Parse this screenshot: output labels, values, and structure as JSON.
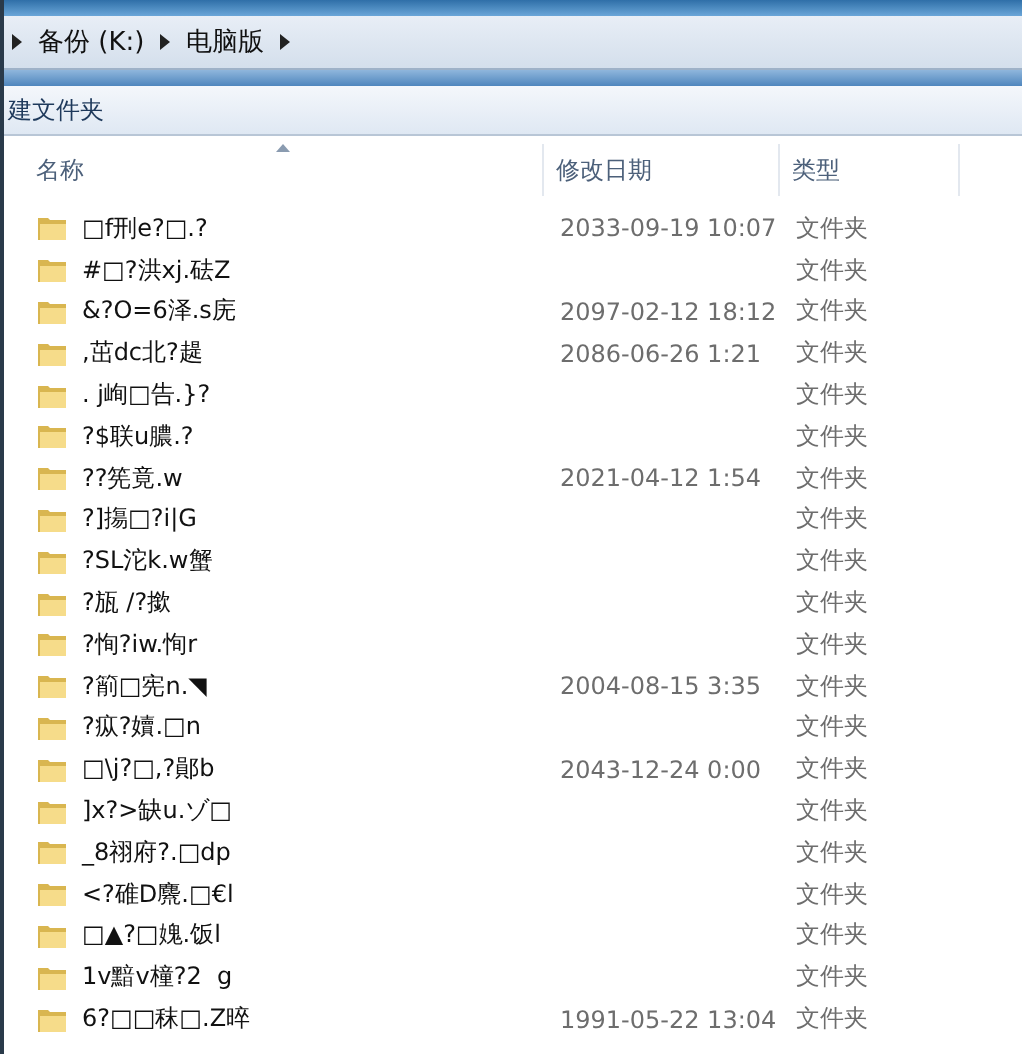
{
  "breadcrumb": [
    {
      "label": "备份 (K:)"
    },
    {
      "label": "电脑版"
    }
  ],
  "toolbar": {
    "new_folder": "建文件夹"
  },
  "table": {
    "columns": [
      "名称",
      "修改日期",
      "类型"
    ],
    "rows": [
      {
        "name": "□f刑e?□.?",
        "date": "2033-09-19 10:07",
        "type": "文件夹"
      },
      {
        "name": "#□?洪xj.砝Z",
        "type": "文件夹"
      },
      {
        "name": "&?O=6泽.s庑",
        "date": "2097-02-12 18:12",
        "type": "文件夹"
      },
      {
        "name": ",茁dc北?趧",
        "date": "2086-06-26 1:21",
        "type": "文件夹"
      },
      {
        "name": ". j峋□告.}?",
        "type": "文件夹"
      },
      {
        "name": "?$联u膿.?",
        "type": "文件夹"
      },
      {
        "name": "??筅竟.w",
        "date": "2021-04-12 1:54",
        "type": "文件夹"
      },
      {
        "name": "?]摥□?i|G",
        "type": "文件夹"
      },
      {
        "name": "?SL沱k.w蟹",
        "type": "文件夹"
      },
      {
        "name": "?瓬 /?撳",
        "type": "文件夹"
      },
      {
        "name": "?恂?iw.恂r",
        "type": "文件夹"
      },
      {
        "name": "?箾□宪n.◥",
        "date": "2004-08-15 3:35",
        "type": "文件夹"
      },
      {
        "name": "?疭?嬻.□n",
        "type": "文件夹"
      },
      {
        "name": "□\\j?□,?鄖b",
        "date": "2043-12-24 0:00",
        "type": "文件夹"
      },
      {
        "name": "]x?>缺u.ゾ□",
        "type": "文件夹"
      },
      {
        "name": "_8祤府?.□dp",
        "type": "文件夹"
      },
      {
        "name": "<?碓D麍.□€l",
        "type": "文件夹"
      },
      {
        "name": "□▲?□媿.饭l",
        "type": "文件夹"
      },
      {
        "name": "1v黯v橦?2  g",
        "type": "文件夹"
      },
      {
        "name": "6?□□秣□.Z晬",
        "date": "1991-05-22 13:04",
        "type": "文件夹"
      }
    ]
  }
}
